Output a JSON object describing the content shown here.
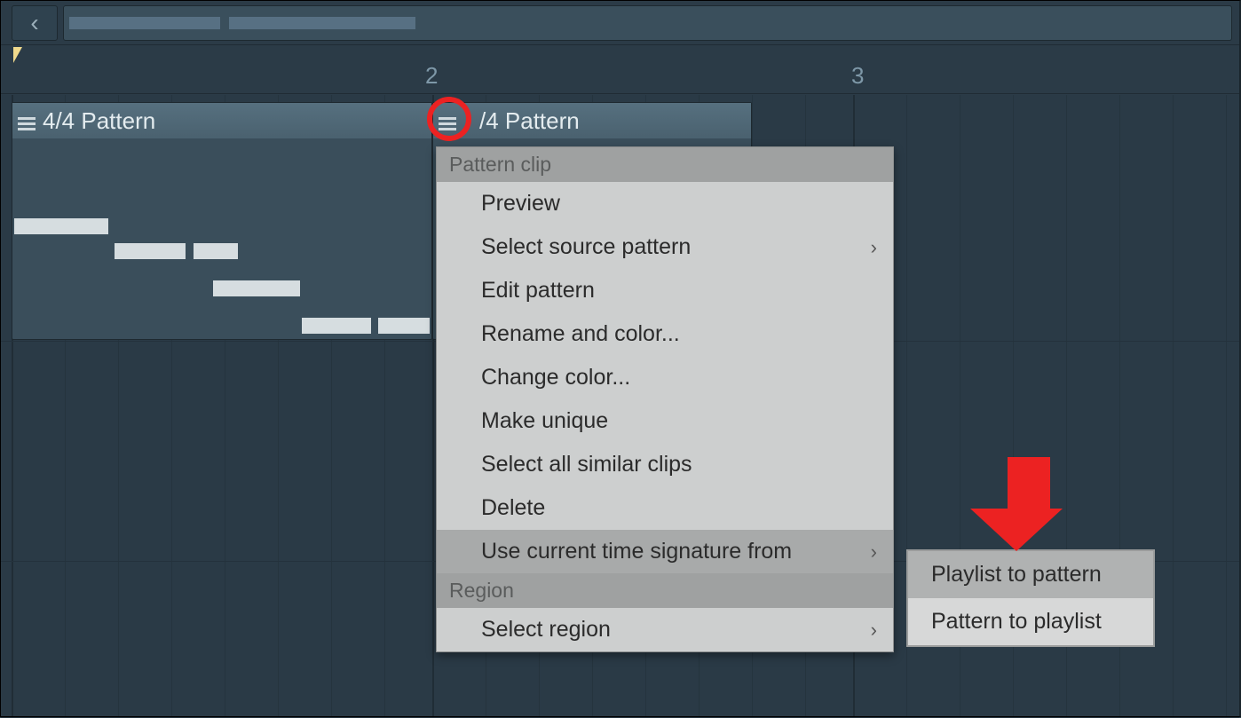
{
  "toolbar": {
    "back_symbol": "‹"
  },
  "ruler": {
    "numbers": [
      "2",
      "3"
    ]
  },
  "clips": [
    {
      "label": "4/4 Pattern"
    },
    {
      "label": "3/4 Pattern",
      "visible_label": "/4 Pattern"
    }
  ],
  "menu": {
    "section1": "Pattern clip",
    "items": [
      {
        "label": "Preview",
        "u": "P"
      },
      {
        "label": "Select source pattern",
        "u": "S",
        "arrow": true
      },
      {
        "label": "Edit pattern",
        "u": "E"
      },
      {
        "label": "Rename and color...",
        "u": "R"
      },
      {
        "label": "Change color...",
        "u": "C"
      },
      {
        "label": "Make unique",
        "u": "M"
      },
      {
        "label": "Select all similar clips"
      },
      {
        "label": "Delete"
      },
      {
        "label": "Use current time signature from",
        "arrow": true,
        "hl": true
      }
    ],
    "section2": "Region",
    "region_items": [
      {
        "label": "Select region",
        "arrow": true
      }
    ]
  },
  "submenu": {
    "items": [
      {
        "label": "Playlist to pattern",
        "hl": true
      },
      {
        "label": "Pattern to playlist"
      }
    ]
  }
}
